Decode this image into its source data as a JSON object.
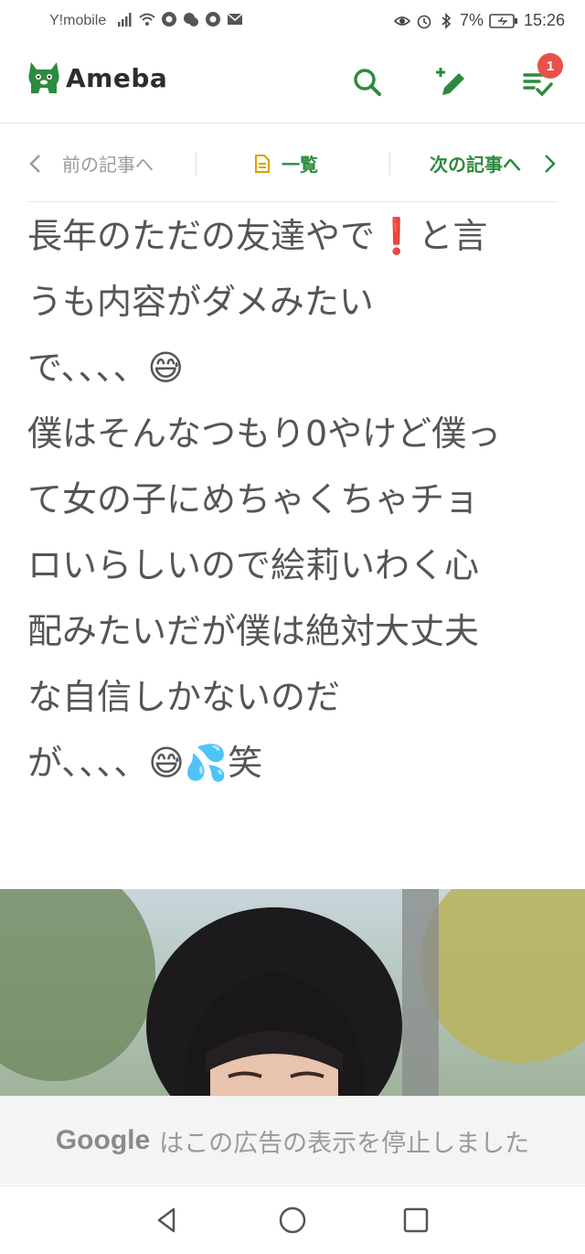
{
  "status_bar": {
    "carrier": "Y!mobile",
    "battery": "7%",
    "time": "15:26"
  },
  "header": {
    "logo_text": "Ameba",
    "notification_count": "1"
  },
  "article_nav": {
    "prev_label": "前の記事へ",
    "list_label": "一覧",
    "next_label": "次の記事へ"
  },
  "article": {
    "lines": [
      "長年のただの友達やで❗と言",
      "うも内容がダメみたい",
      "で、、、、😅",
      "僕はそんなつもり0やけど僕っ",
      "て女の子にめちゃくちゃチョ",
      "ロいらしいので絵莉いわく心",
      "配みたいだが僕は絶対大丈夫",
      "な自信しかないのだ",
      "が、、、、😅💦笑"
    ]
  },
  "ad_notice": {
    "brand": "Google",
    "message": "はこの広告の表示を停止しました"
  },
  "colors": {
    "accent_green": "#2d8a3e",
    "badge_red": "#e8504a"
  }
}
